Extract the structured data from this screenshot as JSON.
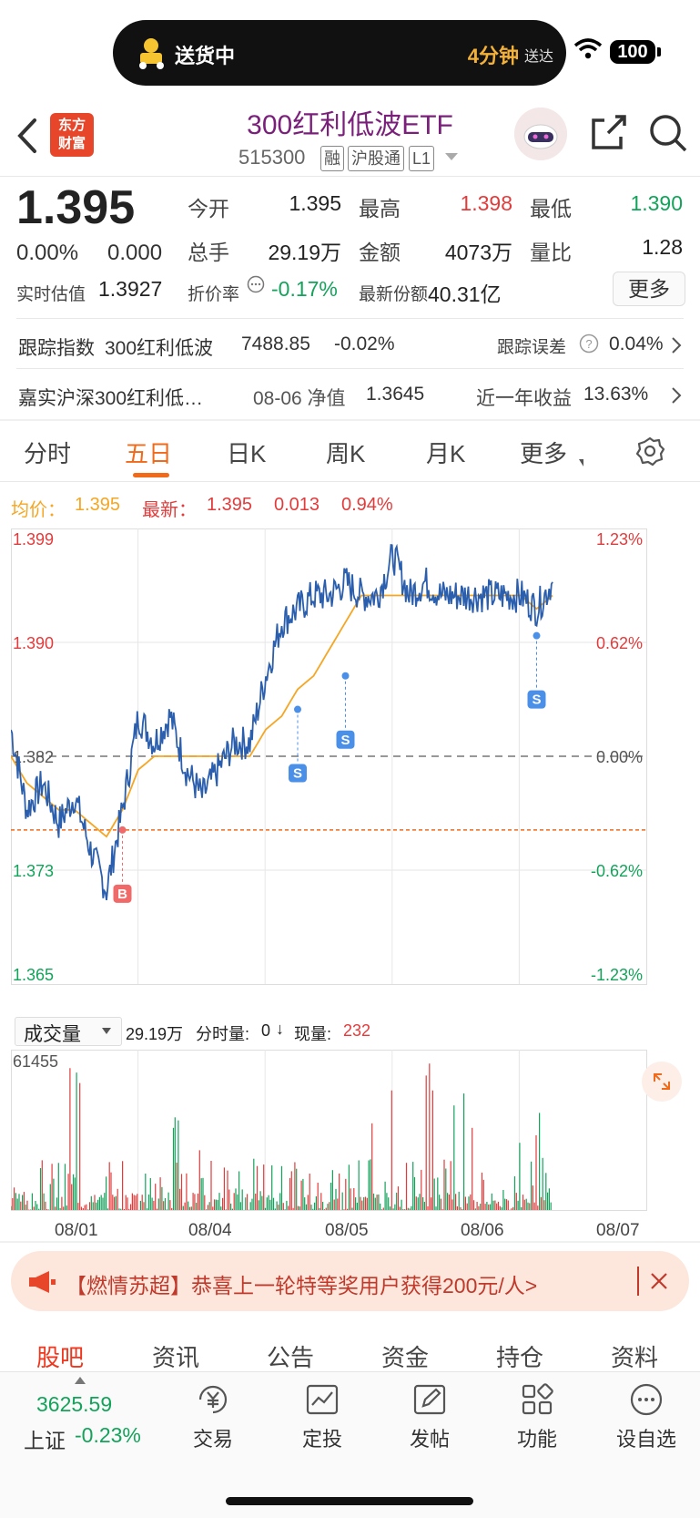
{
  "status": {
    "delivery_text": "送货中",
    "eta_value": "4分钟",
    "eta_suffix": "送达",
    "battery": "100"
  },
  "header": {
    "logo_line1": "东方",
    "logo_line2": "财富",
    "title": "300红利低波ETF",
    "code": "515300",
    "tags": [
      "融",
      "沪股通",
      "L1"
    ]
  },
  "quote": {
    "price": "1.395",
    "change_pct": "0.00%",
    "change_abs": "0.000",
    "rows": [
      [
        {
          "l": "今开",
          "v": "1.395",
          "c": ""
        },
        {
          "l": "最高",
          "v": "1.398",
          "c": "red"
        },
        {
          "l": "最低",
          "v": "1.390",
          "c": "green"
        }
      ],
      [
        {
          "l": "总手",
          "v": "29.19万",
          "c": ""
        },
        {
          "l": "金额",
          "v": "4073万",
          "c": ""
        },
        {
          "l": "量比",
          "v": "1.28",
          "c": ""
        }
      ]
    ],
    "realtime_label": "实时估值",
    "realtime_value": "1.3927",
    "discount_label": "折价率",
    "discount_value": "-0.17%",
    "shares_label": "最新份额",
    "shares_value": "40.31亿",
    "more_label": "更多"
  },
  "tracking": {
    "label": "跟踪指数",
    "index_name": "300红利低波",
    "index_value": "7488.85",
    "index_change": "-0.02%",
    "error_label": "跟踪误差",
    "error_value": "0.04%"
  },
  "fund": {
    "name": "嘉实沪深300红利低…",
    "nav_label": "08-06 净值",
    "nav_value": "1.3645",
    "return_label": "近一年收益",
    "return_value": "13.63%"
  },
  "tabs": [
    "分时",
    "五日",
    "日K",
    "周K",
    "月K",
    "更多"
  ],
  "active_tab": "五日",
  "legend": {
    "avg_label": "均价：",
    "avg_value": "1.395",
    "latest_label": "最新：",
    "latest_value": "1.395",
    "latest_change": "0.013",
    "latest_pct": "0.94%"
  },
  "chart_data": {
    "type": "line",
    "x": [
      "08/01",
      "08/04",
      "08/05",
      "08/06",
      "08/07"
    ],
    "ylim": [
      1.365,
      1.399
    ],
    "y_ticks_left": [
      "1.399",
      "1.390",
      "1.382",
      "1.373",
      "1.365"
    ],
    "y_ticks_right": [
      "1.23%",
      "0.62%",
      "0.00%",
      "-0.62%",
      "-1.23%"
    ],
    "reference": 1.382,
    "buy_line": 1.3765,
    "series": [
      {
        "values": [
          1.384,
          1.378,
          1.38,
          1.377,
          1.379,
          1.375,
          1.372,
          1.378,
          1.385,
          1.383,
          1.385,
          1.381,
          1.379,
          1.381,
          1.383,
          1.383,
          1.388,
          1.392,
          1.393,
          1.394,
          1.394,
          1.395,
          1.394,
          1.394,
          1.397,
          1.394,
          1.395,
          1.394,
          1.394,
          1.394,
          1.394,
          1.394,
          1.394,
          1.393,
          1.395
        ]
      },
      {
        "values": [
          1.382,
          1.38,
          1.379,
          1.378,
          1.378,
          1.377,
          1.376,
          1.378,
          1.381,
          1.382,
          1.382,
          1.382,
          1.382,
          1.382,
          1.382,
          1.382,
          1.384,
          1.385,
          1.387,
          1.388,
          1.39,
          1.392,
          1.394,
          1.394,
          1.394,
          1.394,
          1.394,
          1.394,
          1.394,
          1.394,
          1.394,
          1.394,
          1.394,
          1.393,
          1.394
        ]
      }
    ],
    "markers": [
      {
        "type": "B",
        "x_index": 7,
        "value": 1.3765
      },
      {
        "type": "S",
        "x_index": 18,
        "value": 1.3855
      },
      {
        "type": "S",
        "x_index": 21,
        "value": 1.388
      },
      {
        "type": "S",
        "x_index": 33,
        "value": 1.391
      }
    ]
  },
  "volume": {
    "selector": "成交量",
    "total": "29.19万",
    "minute_label": "分时量:",
    "minute_value": "0",
    "now_label": "现量:",
    "now_value": "232",
    "max_label": "61455"
  },
  "x_labels": [
    "08/01",
    "08/04",
    "08/05",
    "08/06",
    "08/07"
  ],
  "banner": {
    "text": "【燃情苏超】恭喜上一轮特等奖用户获得200元/人>"
  },
  "bottom_tabs": [
    "股吧",
    "资讯",
    "公告",
    "资金",
    "持仓",
    "资料"
  ],
  "active_bottom_tab": "股吧",
  "index_bar": {
    "value": "3625.59",
    "name": "上证",
    "change": "-0.23%"
  },
  "bottom_nav": [
    "交易",
    "定投",
    "发帖",
    "功能",
    "设自选"
  ],
  "colors": {
    "accent": "#f06a1a",
    "up": "#e23b3b",
    "down": "#13a35b",
    "price_line": "#2b5fad",
    "avg_line": "#f5a623"
  }
}
